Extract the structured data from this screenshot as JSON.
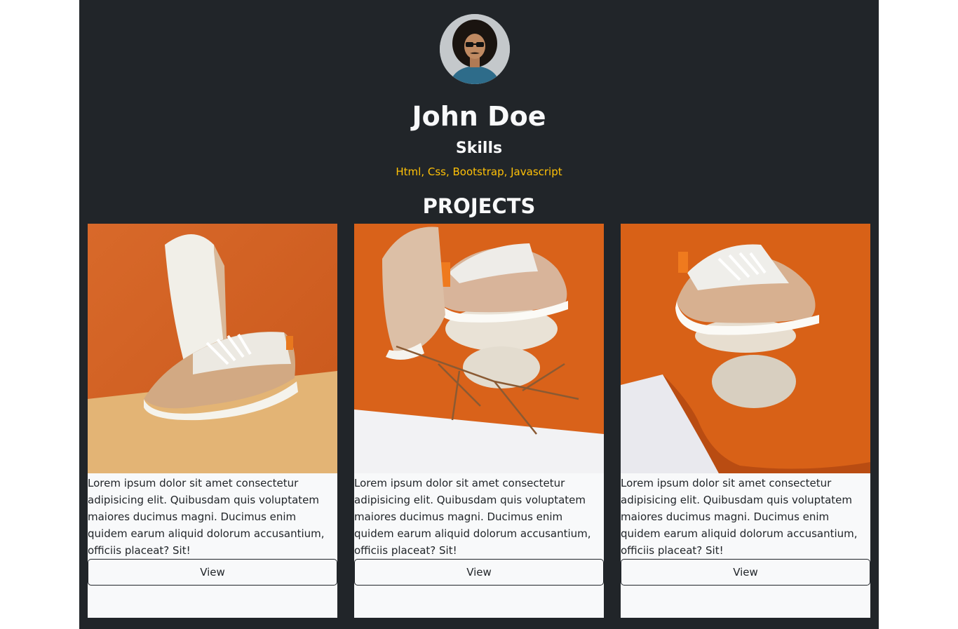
{
  "profile": {
    "name": "John Doe",
    "skills_title": "Skills",
    "skills_list": "Html, Css, Bootstrap, Javascript"
  },
  "section": {
    "title": "PROJECTS"
  },
  "colors": {
    "page_bg": "#212529",
    "accent": "#ffc107",
    "card_bg": "#f8f9fa",
    "card_orange": "#d9621a"
  },
  "projects": [
    {
      "image": "sneaker-photo",
      "description": "Lorem ipsum dolor sit amet consectetur adipisicing elit. Quibusdam quis voluptatem maiores ducimus magni. Ducimus enim quidem earum aliquid dolorum accusantium, officiis placeat? Sit!",
      "button_label": "View"
    },
    {
      "image": "sneaker-on-stones-photo",
      "description": "Lorem ipsum dolor sit amet consectetur adipisicing elit. Quibusdam quis voluptatem maiores ducimus magni. Ducimus enim quidem earum aliquid dolorum accusantium, officiis placeat? Sit!",
      "button_label": "View"
    },
    {
      "image": "sneaker-on-rocks-photo",
      "description": "Lorem ipsum dolor sit amet consectetur adipisicing elit. Quibusdam quis voluptatem maiores ducimus magni. Ducimus enim quidem earum aliquid dolorum accusantium, officiis placeat? Sit!",
      "button_label": "View"
    }
  ]
}
